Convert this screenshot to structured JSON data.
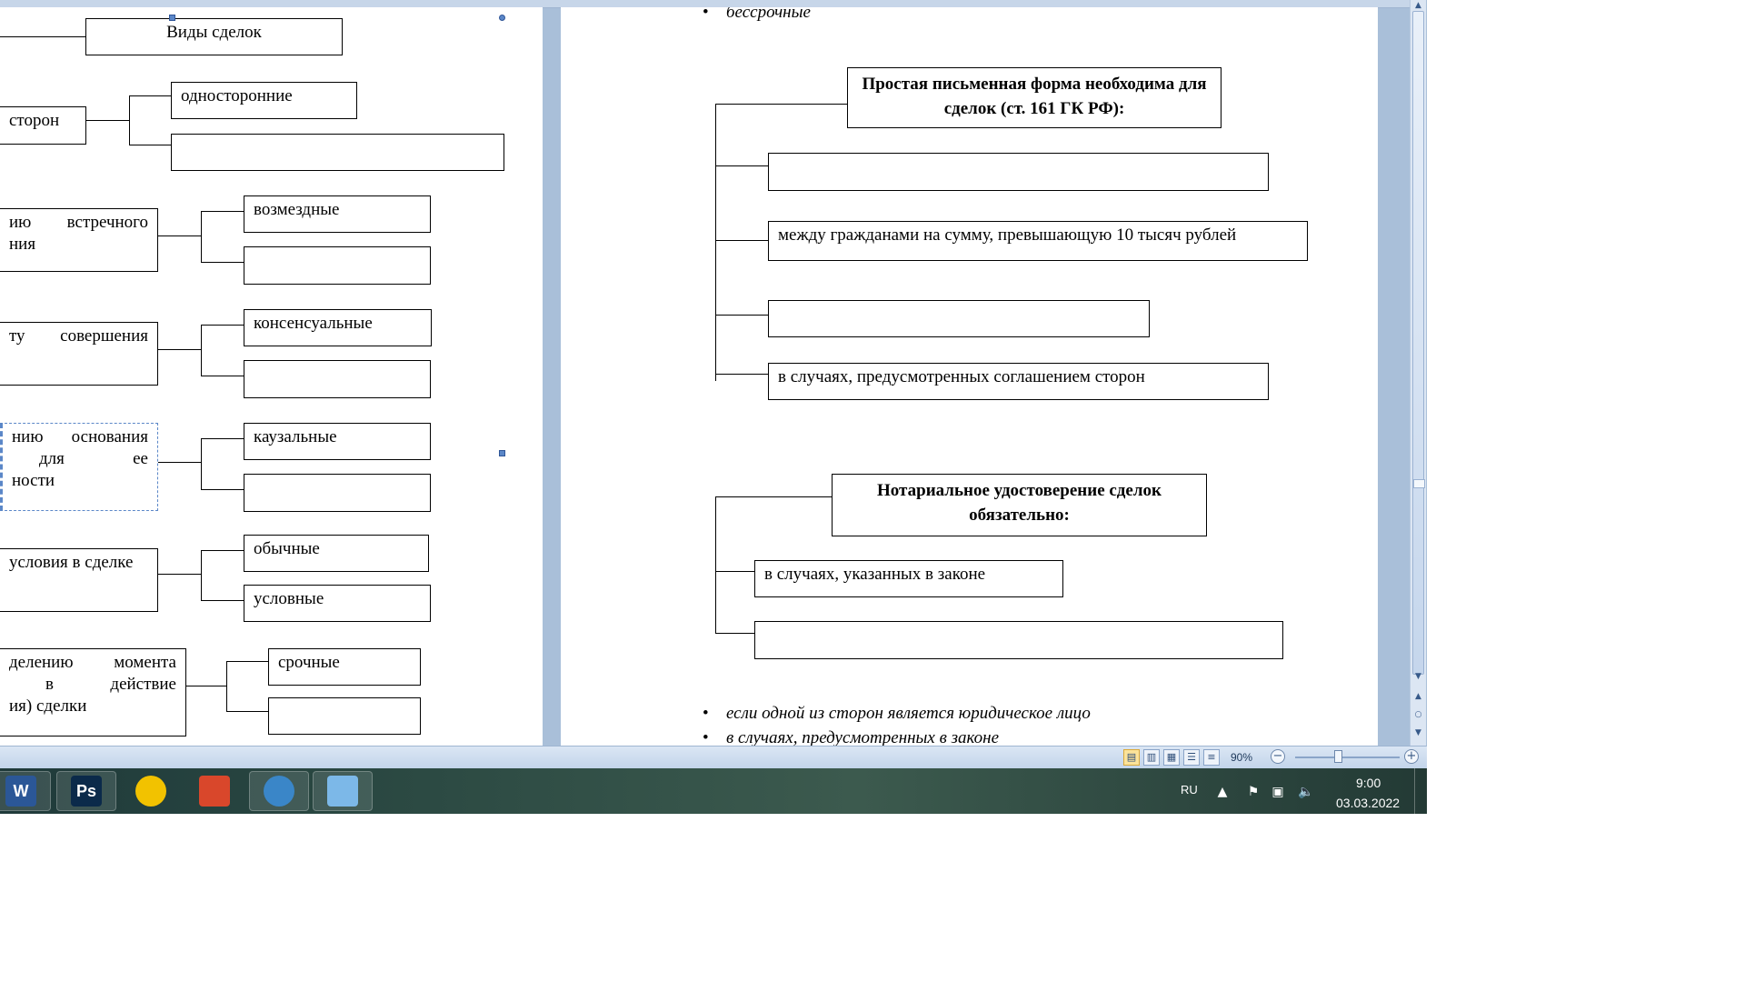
{
  "left_diagram": {
    "root": "Виды  сделок",
    "groups": [
      {
        "criterion_lines": [
          "сторон"
        ],
        "items": [
          "односторонние",
          ""
        ]
      },
      {
        "criterion_lines": [
          "ию встречного",
          "ния"
        ],
        "items": [
          "возмездные",
          ""
        ]
      },
      {
        "criterion_lines": [
          "ту совершения"
        ],
        "items": [
          "консенсуальные",
          ""
        ]
      },
      {
        "criterion_lines": [
          "нию основания",
          "для ее",
          "ности"
        ],
        "items": [
          "каузальные",
          ""
        ]
      },
      {
        "criterion_lines": [
          "условия в сделке"
        ],
        "items": [
          "обычные",
          "условные"
        ]
      },
      {
        "criterion_lines": [
          "делению момента",
          "в действие",
          "ия) сделки"
        ],
        "items": [
          "срочные",
          ""
        ]
      }
    ]
  },
  "right_document": {
    "top_bullet": "бессрочные",
    "simple_form": {
      "title": "Простая письменная форма необходима для сделок (ст. 161 ГК РФ):",
      "items": [
        "",
        "между гражданами на сумму, превышающую 10 тысяч рублей",
        "",
        "в случаях, предусмотренных соглашением сторон"
      ]
    },
    "notarial": {
      "title": "Нотариальное удостоверение сделок обязательно:",
      "items": [
        "в случаях, указанных в законе",
        ""
      ]
    },
    "bottom_bullets": [
      "если одной из сторон является юридическое лицо",
      "в случаях, предусмотренных в законе"
    ]
  },
  "status_bar": {
    "zoom_level": "90%"
  },
  "taskbar": {
    "apps": [
      {
        "name": "word-icon",
        "label": "W",
        "color": "#2b5797"
      },
      {
        "name": "photoshop-icon",
        "label": "Ps",
        "color": "#0b2a4a"
      },
      {
        "name": "green-app-icon",
        "label": "",
        "color": "#f2c200"
      },
      {
        "name": "presentation-icon",
        "label": "",
        "color": "#d9472b"
      },
      {
        "name": "media-player-icon",
        "label": "",
        "color": "#3a86c8"
      },
      {
        "name": "paint-icon",
        "label": "",
        "color": "#7cb8e8"
      }
    ],
    "language": "RU",
    "time": "9:00",
    "date": "03.03.2022"
  }
}
